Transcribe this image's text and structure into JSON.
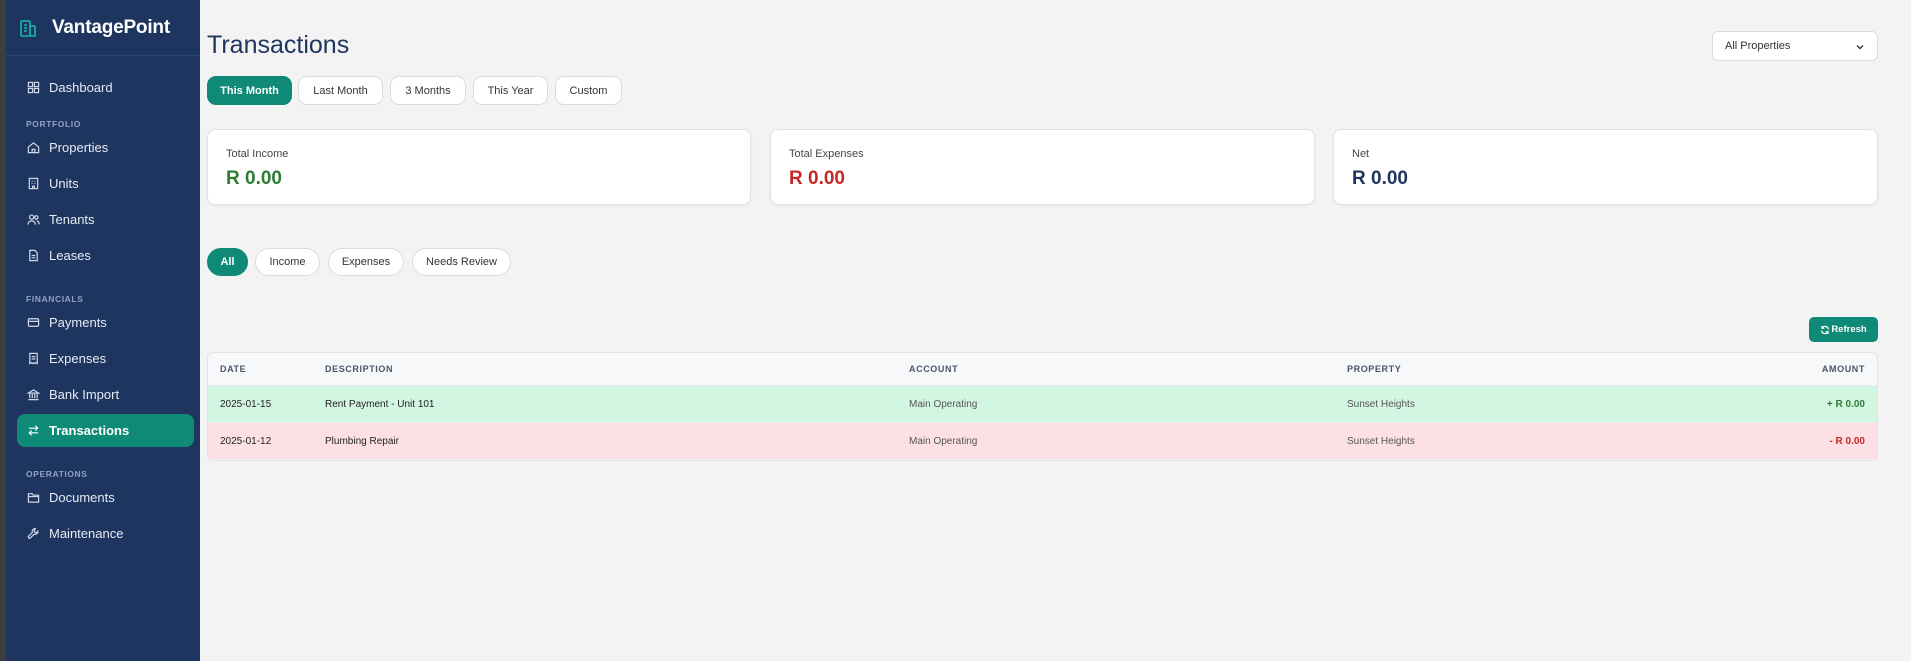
{
  "app": {
    "name": "VantagePoint"
  },
  "sidebar": {
    "items": [
      {
        "label": "Dashboard",
        "icon": "grid-icon"
      },
      {
        "label": "Properties",
        "icon": "home-icon"
      },
      {
        "label": "Units",
        "icon": "building-icon"
      },
      {
        "label": "Tenants",
        "icon": "users-icon"
      },
      {
        "label": "Leases",
        "icon": "file-icon"
      },
      {
        "label": "Payments",
        "icon": "credit-card-icon"
      },
      {
        "label": "Expenses",
        "icon": "receipt-icon"
      },
      {
        "label": "Bank Import",
        "icon": "bank-icon"
      },
      {
        "label": "Transactions",
        "icon": "arrows-icon",
        "active": true
      },
      {
        "label": "Documents",
        "icon": "folder-icon"
      },
      {
        "label": "Maintenance",
        "icon": "wrench-icon"
      }
    ],
    "sections": [
      "PORTFOLIO",
      "FINANCIALS",
      "OPERATIONS"
    ]
  },
  "page": {
    "title": "Transactions",
    "property_filter": "All Properties"
  },
  "periods": [
    "This Month",
    "Last Month",
    "3 Months",
    "This Year",
    "Custom"
  ],
  "active_period": "This Month",
  "summary": {
    "income_label": "Total Income",
    "income_value": "R 0.00",
    "expenses_label": "Total Expenses",
    "expenses_value": "R 0.00",
    "net_label": "Net",
    "net_value": "R 0.00"
  },
  "type_filters": [
    "All",
    "Income",
    "Expenses",
    "Needs Review"
  ],
  "active_type_filter": "All",
  "refresh_label": "Refresh",
  "table": {
    "columns": [
      "DATE",
      "DESCRIPTION",
      "ACCOUNT",
      "PROPERTY",
      "AMOUNT"
    ],
    "rows": [
      {
        "date": "2025-01-15",
        "description": "Rent Payment - Unit 101",
        "account": "Main Operating",
        "property": "Sunset Heights",
        "amount": "+ R 0.00",
        "kind": "income"
      },
      {
        "date": "2025-01-12",
        "description": "Plumbing Repair",
        "account": "Main Operating",
        "property": "Sunset Heights",
        "amount": "- R 0.00",
        "kind": "expense"
      }
    ]
  },
  "colors": {
    "sidebar": "#1e3560",
    "accent": "#0e8a76",
    "income": "#2e7d32",
    "expense": "#c62828",
    "net": "#1e3560",
    "income_row": "#d3f6e3",
    "expense_row": "#fde0e3"
  }
}
